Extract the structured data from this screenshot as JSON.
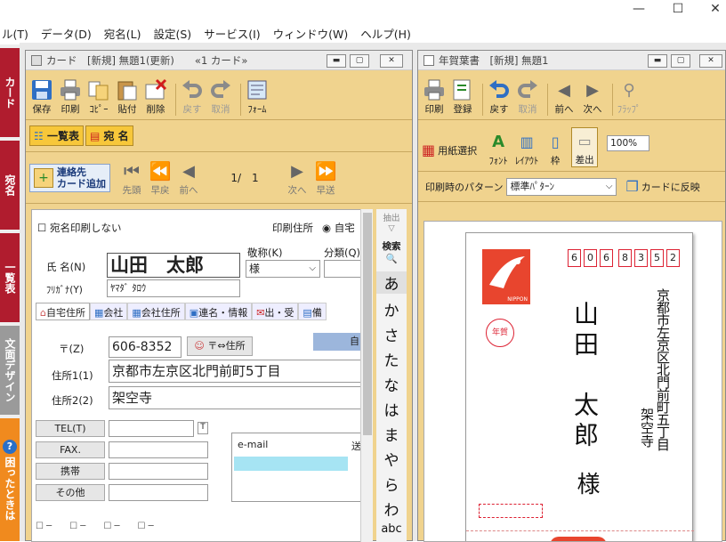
{
  "menu": [
    "ル(T)",
    "データ(D)",
    "宛名(L)",
    "設定(S)",
    "サービス(I)",
    "ウィンドウ(W)",
    "ヘルプ(H)"
  ],
  "window_controls": {
    "minimize": "—",
    "maximize": "☐",
    "close": "✕"
  },
  "side_tabs": [
    {
      "label": "カード",
      "color": "#b01c2e"
    },
    {
      "label": "宛名",
      "color": "#b01c2e"
    },
    {
      "label": "一覧表",
      "color": "#b01c2e"
    },
    {
      "label": "文面デザイン",
      "color": "#9a9a9a"
    },
    {
      "label": "困ったときは",
      "color": "#f08a1e"
    }
  ],
  "card_window": {
    "title": "カード　[新規] 無題1(更新)　　«1 カード»",
    "toolbar": [
      "保存",
      "印刷",
      "ｺﾋﾟｰ",
      "貼付",
      "削除",
      "戻す",
      "取消",
      "ﾌｫｰﾑ"
    ],
    "view_tabs": [
      "一覧表",
      "宛 名"
    ],
    "add_contact": "連絡先\nカード追加",
    "nav": {
      "first": "先頭",
      "fast_back": "早戻",
      "prev": "前へ",
      "position": "1/　1",
      "next": "次へ",
      "fast_fwd": "早送"
    },
    "no_address_print": "宛名印刷しない",
    "print_address_label": "印刷住所",
    "print_address_value": "自宅",
    "honorific_label": "敬称(K)",
    "category_label": "分類(Q)",
    "name_label": "氏  名(N)",
    "name_value": "山田　太郎",
    "honorific_value": "様",
    "furigana_label": "ﾌﾘｶﾞﾅ(Y)",
    "furigana_value": "ﾔﾏﾀﾞ ﾀﾛｳ",
    "subtabs": [
      "自宅住所",
      "会社",
      "会社住所",
      "連名・情報",
      "出・受",
      "備"
    ],
    "zip_label": "〒(Z)",
    "zip_value": "606-8352",
    "zip_button": "〒⇔住所",
    "home_chip": "自",
    "addr1_label": "住所1(1)",
    "addr1_value": "京都市左京区北門前町5丁目",
    "addr2_label": "住所2(2)",
    "addr2_value": "架空寺",
    "phone_labels": [
      "TEL(T)",
      "FAX.",
      "携帯",
      "その他"
    ],
    "email_label": "e-mail",
    "email_side": "送",
    "index_extract": "抽出",
    "index_search": "検索",
    "index_kana": [
      "あ",
      "か",
      "さ",
      "た",
      "な",
      "は",
      "ま",
      "や",
      "ら",
      "わ",
      "abc"
    ]
  },
  "nenga_window": {
    "title": "年賀葉書　[新規] 無題1",
    "toolbar": [
      "印刷",
      "登録",
      "戻す",
      "取消",
      "前へ",
      "次へ",
      "ﾌﾗｯﾌﾟ"
    ],
    "toolbar2": [
      "用紙選択",
      "ﾌｫﾝﾄ",
      "ﾚｲｱｳﾄ",
      "枠",
      "差出"
    ],
    "zoom": "100%",
    "pattern_label": "印刷時のパターン",
    "pattern_value": "標準ﾊﾟﾀｰﾝ",
    "reflect_button": "カードに反映",
    "postcard": {
      "zip_digits": [
        "6",
        "0",
        "6",
        "8",
        "3",
        "5",
        "2"
      ],
      "address_line1": "京都市左京区北門前町五丁目",
      "address_line2": "架空寺",
      "recipient_name": "山田　太郎",
      "honorific": "様",
      "stamp_brand": "NIPPON",
      "nenga_mark": "年賀"
    }
  },
  "colors": {
    "accent_red": "#b01c2e",
    "toolbar_bg": "#f0d38e",
    "email_highlight": "#a6e4f3"
  }
}
